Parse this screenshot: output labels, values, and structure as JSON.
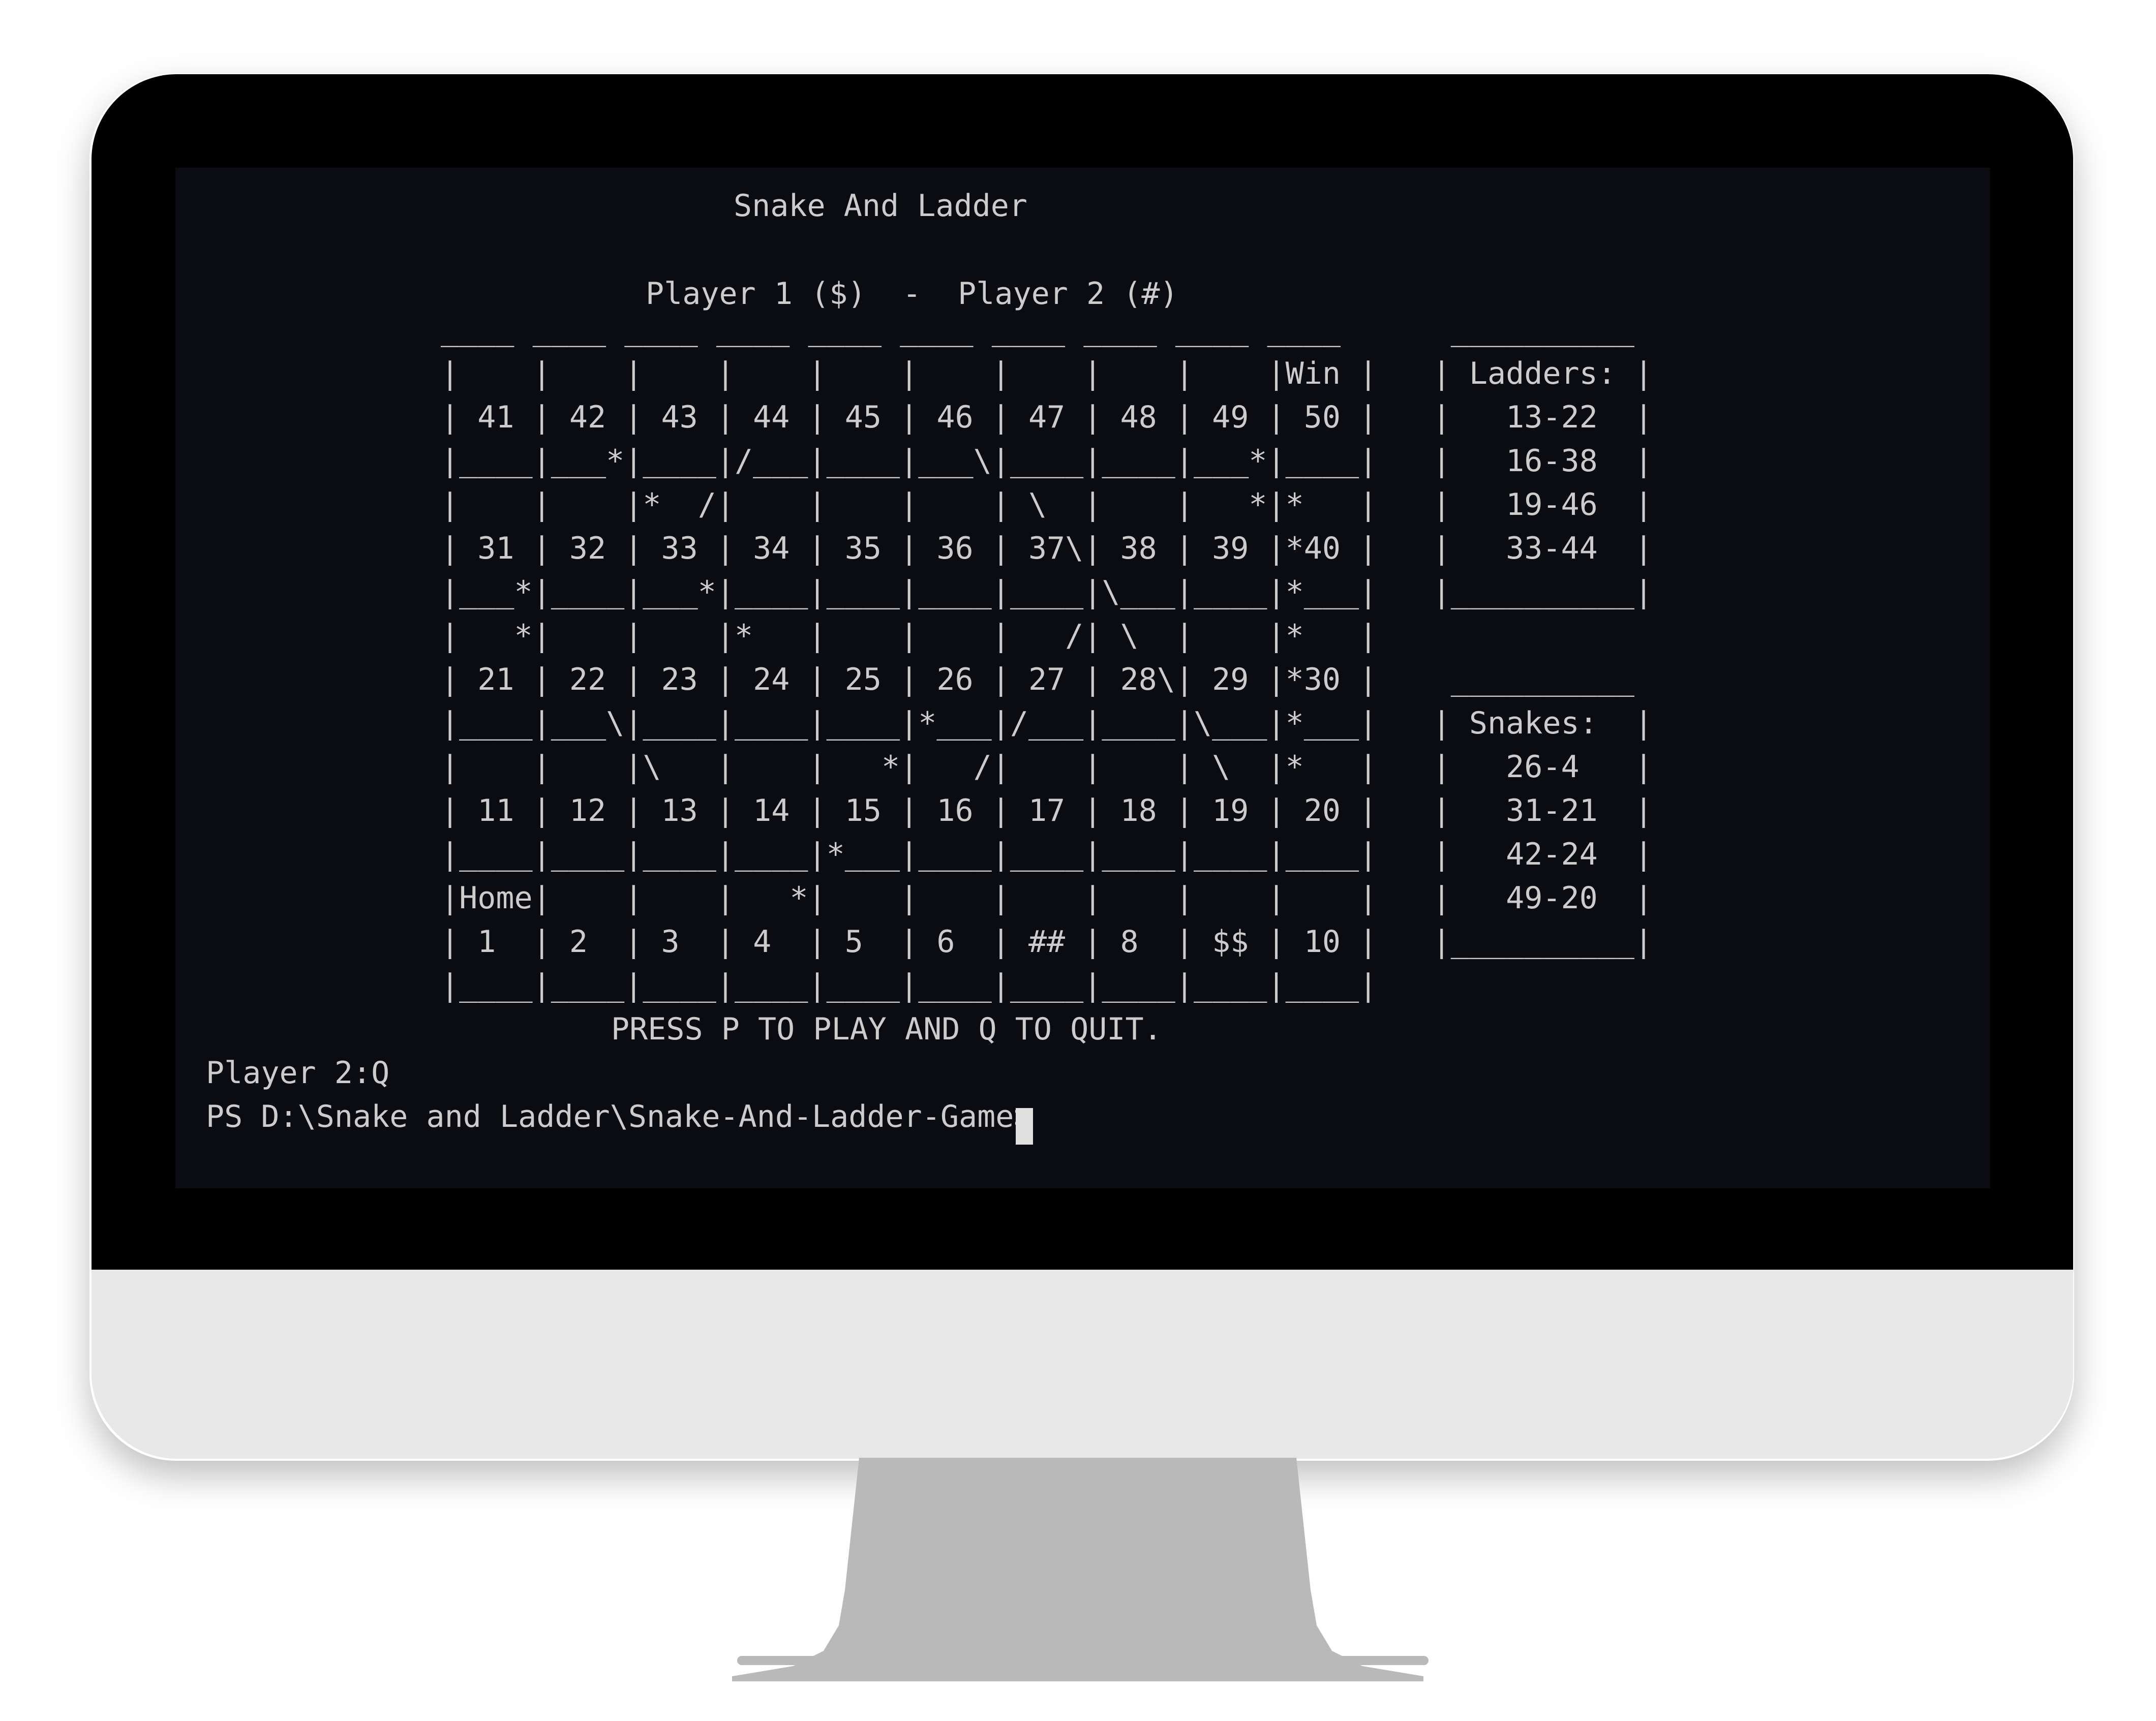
{
  "title": "Snake And Ladder",
  "players_line": "Player 1 ($)  -  Player 2 (#)",
  "board_rows": [
    "____ ____ ____ ____ ____ ____ ____ ____ ____ ____      __________",
    "|    |    |    |    |    |    |    |    |    |Win |   | Ladders: |",
    "| 41 | 42 | 43 | 44 | 45 | 46 | 47 | 48 | 49 | 50 |   |   13-22  |",
    "|____|___*|____|/___|____|___\\|____|____|___*|____|   |   16-38  |",
    "|    |    |*  /|    |    |    | \\  |    |   *|*   |   |   19-46  |",
    "| 31 | 32 | 33 | 34 | 35 | 36 | 37\\| 38 | 39 |*40 |   |   33-44  |",
    "|___*|____|___*|____|____|____|____|\\___|____|*___|   |__________|",
    "|   *|    |    |*   |    |    |   /| \\  |    |*   |",
    "| 21 | 22 | 23 | 24 | 25 | 26 | 27 | 28\\| 29 |*30 |    __________",
    "|____|___\\|____|____|____|*___|/___|____|\\___|*___|   | Snakes:  |",
    "|    |    |\\   |    |   *|   /|    |    | \\  |*   |   |   26-4   |",
    "| 11 | 12 | 13 | 14 | 15 | 16 | 17 | 18 | 19 | 20 |   |   31-21  |",
    "|____|____|____|____|*___|____|____|____|____|____|   |   42-24  |",
    "|Home|    |    |   *|    |    |    |    |    |    |   |   49-20  |",
    "| 1  | 2  | 3  | 4  | 5  | 6  | ## | 8  | $$ | 10 |   |__________|",
    "|____|____|____|____|____|____|____|____|____|____|"
  ],
  "prompt_line": "PRESS P TO PLAY AND Q TO QUIT.",
  "input_line": "Player 2:Q",
  "shell_prompt": "PS D:\\Snake and Ladder\\Snake-And-Ladder-Game>"
}
